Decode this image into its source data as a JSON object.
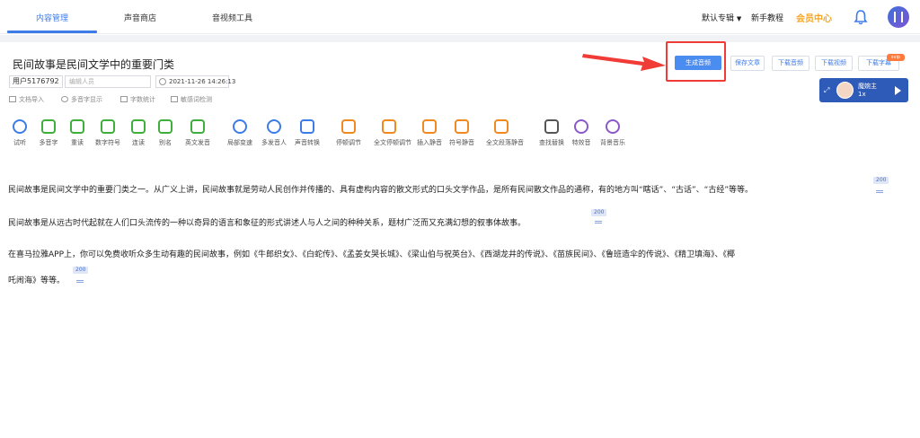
{
  "nav": {
    "tabs": [
      {
        "label": "内容管理",
        "active": true
      },
      {
        "label": "声音商店",
        "active": false
      },
      {
        "label": "音视频工具",
        "active": false
      }
    ],
    "album_select": "默认专辑",
    "tutorial": "新手教程",
    "vip_center": "会员中心"
  },
  "doc": {
    "title": "民间故事是民间文学中的重要门类",
    "user_id": "用户5176792",
    "editor_placeholder": "编辑人员",
    "datetime": "2021-11-26 14:26:13",
    "sub_actions": [
      "文档导入",
      "多音字显示",
      "字数统计",
      "敏感词检测"
    ]
  },
  "actions": {
    "generate": "生成音频",
    "save": "保存文章",
    "download_audio": "下载音频",
    "download_video": "下载视频",
    "download_subtitle": "下载字幕",
    "vip_tag": "svip"
  },
  "voice": {
    "name": "魔婉主",
    "speed": "1x"
  },
  "toolbar": [
    {
      "label": "试听",
      "icon": "play-circle-icon",
      "color": "#3c7be8"
    },
    {
      "label": "多音字",
      "icon": "polyphone-icon",
      "color": "#3fae3c"
    },
    {
      "label": "重读",
      "icon": "stress-icon",
      "color": "#3fae3c"
    },
    {
      "label": "数字符号",
      "icon": "number-symbol-icon",
      "color": "#3fae3c"
    },
    {
      "label": "连读",
      "icon": "liaison-icon",
      "color": "#3fae3c"
    },
    {
      "label": "别名",
      "icon": "alias-icon",
      "color": "#3fae3c"
    },
    {
      "label": "英文发音",
      "icon": "english-icon",
      "color": "#3fae3c"
    },
    {
      "label": "局部变速",
      "icon": "speed-icon",
      "color": "#3c7be8"
    },
    {
      "label": "多发音人",
      "icon": "multi-speaker-icon",
      "color": "#3c7be8"
    },
    {
      "label": "声音转换",
      "icon": "voice-convert-icon",
      "color": "#3c7be8"
    },
    {
      "label": "停顿调节",
      "icon": "pause-adjust-icon",
      "color": "#f08a1e"
    },
    {
      "label": "全文停顿调节",
      "icon": "full-pause-icon",
      "color": "#f08a1e"
    },
    {
      "label": "插入静音",
      "icon": "insert-silence-icon",
      "color": "#f08a1e"
    },
    {
      "label": "符号静音",
      "icon": "symbol-silence-icon",
      "color": "#f08a1e"
    },
    {
      "label": "全文段落静音",
      "icon": "paragraph-silence-icon",
      "color": "#f08a1e"
    },
    {
      "label": "查找替换",
      "icon": "find-replace-icon",
      "color": "#555555"
    },
    {
      "label": "特效音",
      "icon": "sound-effect-icon",
      "color": "#8a58c8"
    },
    {
      "label": "背景音乐",
      "icon": "bgm-icon",
      "color": "#8a58c8"
    }
  ],
  "paragraphs": [
    {
      "text": "民间故事是民间文学中的重要门类之一。从广义上讲，民间故事就是劳动人民创作并传播的、具有虚构内容的散文形式的口头文学作品，是所有民间散文作品的通称，有的地方叫“瞎话”、“古话”、“古经”等等。",
      "count": "200"
    },
    {
      "text": "民间故事是从远古时代起就在人们口头流传的一种以奇异的语言和象征的形式讲述人与人之间的种种关系，题材广泛而又充满幻想的叙事体故事。",
      "count": "200"
    },
    {
      "text": "在喜马拉雅APP上，你可以免费收听众多生动有趣的民间故事，例如《牛郎织女》、《白蛇传》、《孟姜女哭长城》、《梁山伯与祝英台》、《西湖龙井的传说》、《苗族民间》、《鲁班造伞的传说》、《精卫填海》、《椰",
      "line2": "吒闹海》等等。",
      "count": "200"
    }
  ]
}
